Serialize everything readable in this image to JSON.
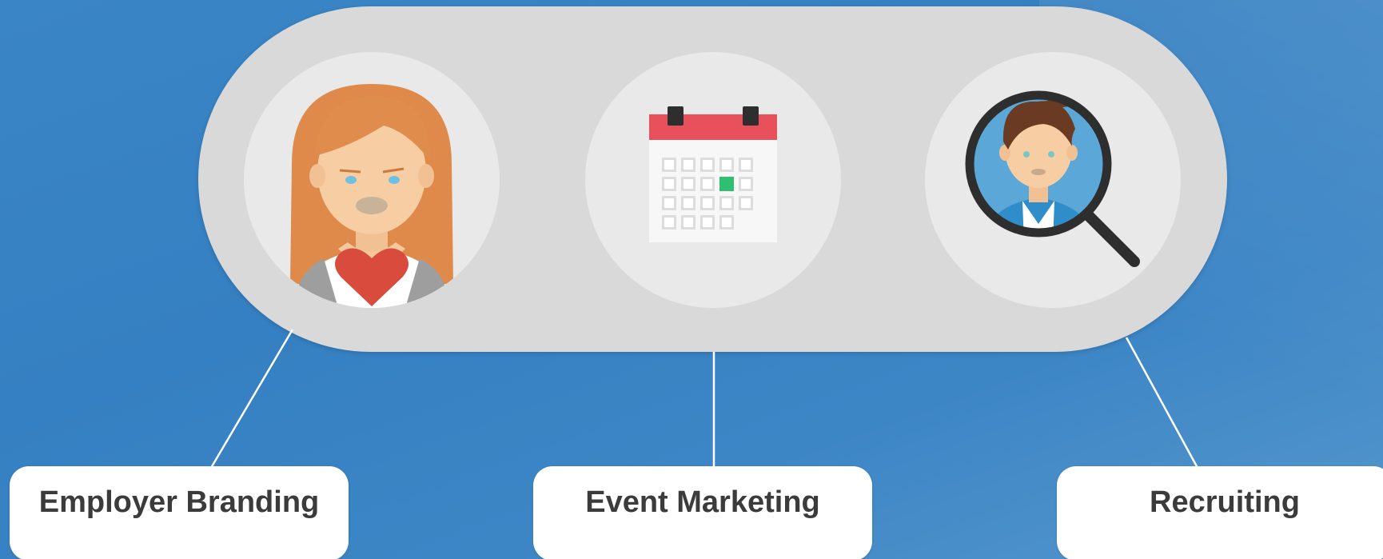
{
  "labels": {
    "employer_branding": "Employer Branding",
    "event_marketing": "Event Marketing",
    "recruiting": "Recruiting"
  },
  "icons": {
    "icon_1": "woman-with-heart-icon",
    "icon_2": "calendar-icon",
    "icon_3": "magnifier-person-icon"
  },
  "colors": {
    "background": "#3580c2",
    "pill": "#d9d9d9",
    "icon_circle": "#e9e9e9",
    "label_box": "#ffffff",
    "label_text": "#3b3b3b",
    "connector": "#ffffff"
  }
}
